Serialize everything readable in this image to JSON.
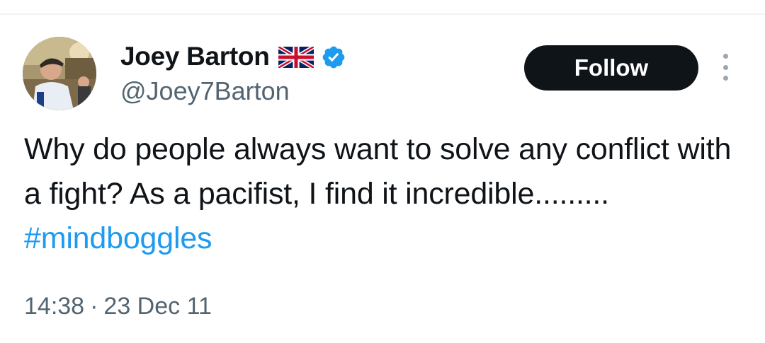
{
  "tweet": {
    "author": {
      "display_name": "Joey Barton",
      "handle": "@Joey7Barton",
      "flag_icon": "uk-flag-icon",
      "verified_icon": "verified-badge-icon",
      "verified_color": "#1d9bf0"
    },
    "follow_label": "Follow",
    "text_main": "Why do people always want to solve any conflict with a fight? As a pacifist, I find it incredible......... ",
    "hashtag": "#mindboggles",
    "time": "14:38",
    "separator": "·",
    "date": "23 Dec 11",
    "colors": {
      "text": "#0f1419",
      "secondary": "#536471",
      "link": "#1d9bf0",
      "button_bg": "#0f1419"
    }
  }
}
